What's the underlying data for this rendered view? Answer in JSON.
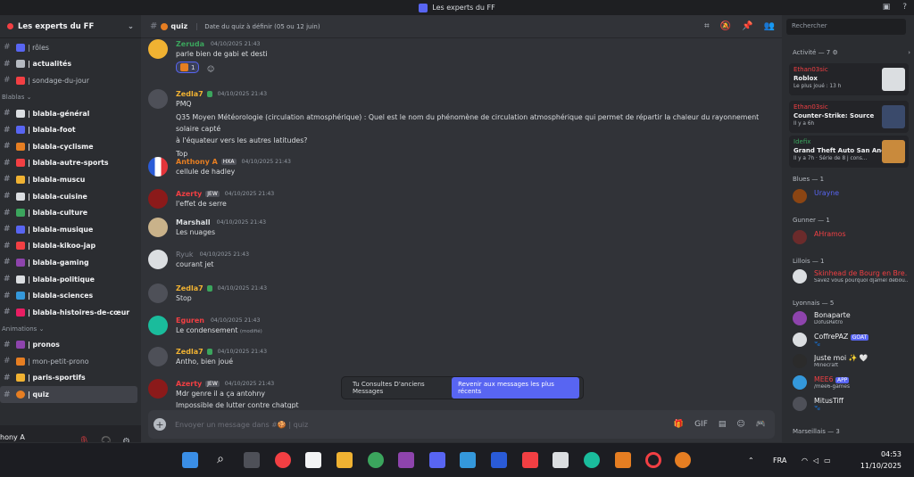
{
  "window": {
    "title": "Les experts du FF"
  },
  "server": {
    "name": "Les experts du FF"
  },
  "channels": [
    {
      "label": "| rôles",
      "color": "#5865f2",
      "unread": false
    },
    {
      "label": "| actualités",
      "color": "#b5bac1",
      "unread": true
    },
    {
      "label": "| sondage-du-jour",
      "color": "#f23f43",
      "unread": false
    }
  ],
  "cat_blabla": "Blablas",
  "blabla_channels": [
    {
      "label": "| blabla-général",
      "color": "#dbdee1"
    },
    {
      "label": "| blabla-foot",
      "color": "#5865f2"
    },
    {
      "label": "| blabla-cyclisme",
      "color": "#e67e22"
    },
    {
      "label": "| blabla-autre-sports",
      "color": "#f23f43"
    },
    {
      "label": "| blabla-muscu",
      "color": "#f0b232"
    },
    {
      "label": "| blabla-cuisine",
      "color": "#dbdee1"
    },
    {
      "label": "| blabla-culture",
      "color": "#3ba55d"
    },
    {
      "label": "| blabla-musique",
      "color": "#5865f2"
    },
    {
      "label": "| blabla-kikoo-jap",
      "color": "#f23f43"
    },
    {
      "label": "| blabla-gaming",
      "color": "#8e44ad"
    },
    {
      "label": "| blabla-politique",
      "color": "#dbdee1"
    },
    {
      "label": "| blabla-sciences",
      "color": "#3498db"
    },
    {
      "label": "| blabla-histoires-de-cœur",
      "color": "#e91e63"
    }
  ],
  "cat_animations": "Animations",
  "anim_channels": [
    {
      "label": "| pronos",
      "color": "#8e44ad",
      "unread": true
    },
    {
      "label": "| mon-petit-prono",
      "color": "#e67e22",
      "unread": false
    },
    {
      "label": "| paris-sportifs",
      "color": "#f0b232",
      "unread": true
    },
    {
      "label": "| quiz",
      "color": "#e67e22",
      "unread": true
    }
  ],
  "user": {
    "name": "hony A",
    "status": "ne"
  },
  "channel_header": {
    "name": "quiz",
    "topic": "Date du quiz à définir (05 ou 12 juin)"
  },
  "messages": [
    {
      "author": "Zeruda",
      "color": "#3ba55d",
      "time": "04/10/2025 21:43",
      "lines": [
        "parle bien de gabi et desti"
      ],
      "avatar": "#f0b232",
      "reaction_count": "1"
    },
    {
      "author": "Zedla7",
      "color": "#f0b232",
      "time": "04/10/2025 21:43",
      "lines": [
        "PMQ",
        "Q35 Moyen Météorologie (circulation atmosphérique) : Quel est le nom du phénomène de circulation atmosphérique qui permet de répartir la chaleur du rayonnement solaire capté",
        "à l'équateur vers les autres latitudes?",
        "Top"
      ],
      "avatar": "#4e5058"
    },
    {
      "author": "Anthony A",
      "color": "#e67e22",
      "badge": "HXA",
      "time": "04/10/2025 21:43",
      "lines": [
        "cellule de hadley"
      ],
      "avatar": "#2a5bd7"
    },
    {
      "author": "Azerty",
      "color": "#f23f43",
      "badge": "JEW",
      "time": "04/10/2025 21:43",
      "lines": [
        "l'effet de serre"
      ],
      "avatar": "#8b1a1a"
    },
    {
      "author": "Marshall",
      "color": "#dbdee1",
      "time": "04/10/2025 21:43",
      "lines": [
        "Les nuages"
      ],
      "avatar": "#c9b28a"
    },
    {
      "author": "Ryuk",
      "color": "#80848e",
      "time": "04/10/2025 21:43",
      "lines": [
        "courant jet"
      ],
      "avatar": "#dbdee1"
    },
    {
      "author": "Zedla7",
      "color": "#f0b232",
      "time": "04/10/2025 21:43",
      "lines": [
        "Stop"
      ],
      "avatar": "#4e5058"
    },
    {
      "author": "Eguren",
      "color": "#f23f43",
      "time": "04/10/2025 21:43",
      "lines": [
        "Le condensement"
      ],
      "edited": "(modifié)",
      "avatar": "#1abc9c"
    },
    {
      "author": "Zedla7",
      "color": "#f0b232",
      "time": "04/10/2025 21:43",
      "lines": [
        "Antho, bien joué"
      ],
      "avatar": "#4e5058"
    },
    {
      "author": "Azerty",
      "color": "#f23f43",
      "badge": "JEW",
      "time": "04/10/2025 21:43",
      "lines": [
        "Mdr genre il a ça antohny",
        "Impossible de lutter contre chatgpt"
      ],
      "avatar": "#8b1a1a"
    }
  ],
  "jump": {
    "text": "Tu Consultes D'anciens Messages",
    "button": "Revenir aux messages les plus récents"
  },
  "composer": {
    "placeholder": "Envoyer un message dans #🍪 | quiz"
  },
  "search": {
    "placeholder": "Rechercher"
  },
  "activity": {
    "header": "Activité — 7",
    "items": [
      {
        "name": "Ethan03sic",
        "game": "Roblox",
        "meta": "Le plus joué : 13 h",
        "name_color": "#f23f43",
        "thumb": "#dbdee1"
      },
      {
        "name": "Ethan03sic",
        "game": "Counter-Strike: Source",
        "meta": "Il y a 6h",
        "name_color": "#f23f43",
        "thumb": "#3a4a6b"
      },
      {
        "name": "Idefix",
        "game": "Grand Theft Auto San And...",
        "meta": "Il y a 7h · Série de 8 j cons...",
        "name_color": "#3ba55d",
        "thumb": "#c98a3c"
      }
    ]
  },
  "member_groups": [
    {
      "title": "Blues — 1",
      "members": [
        {
          "name": "Urayne",
          "color": "#5865f2",
          "status": "",
          "avatar": "#8b4513"
        }
      ]
    },
    {
      "title": "Gunner — 1",
      "members": [
        {
          "name": "AHramos",
          "color": "#f23f43",
          "status": "",
          "avatar": "#6b2b2b"
        }
      ]
    },
    {
      "title": "Lillois — 1",
      "members": [
        {
          "name": "Skinhead de Bourg en Bre...",
          "color": "#f23f43",
          "status": "Savez vous pourquoi djamel debou...",
          "avatar": "#dbdee1"
        }
      ]
    },
    {
      "title": "Lyonnais — 5",
      "members": [
        {
          "name": "Bonaparte",
          "color": "#f2f3f5",
          "status": "DofusRetro",
          "avatar": "#8e44ad"
        },
        {
          "name": "CoffrePAZ",
          "color": "#f2f3f5",
          "status": "🐾",
          "tag": "GOAT",
          "avatar": "#dbdee1"
        },
        {
          "name": "Juste moi ✨ 🤍",
          "color": "#f2f3f5",
          "status": "Minecraft",
          "avatar": "#2b2b2b"
        },
        {
          "name": "MEE6",
          "color": "#f23f43",
          "status": "/mee6-games",
          "tag": "APP",
          "avatar": "#3498db"
        },
        {
          "name": "MitusTiff",
          "color": "#f2f3f5",
          "status": "🐾",
          "avatar": "#4e5058"
        }
      ]
    },
    {
      "title": "Marseillais — 3",
      "members": []
    }
  ],
  "taskbar": {
    "lang": "FRA",
    "time": "04:53",
    "date": "11/10/2025"
  }
}
